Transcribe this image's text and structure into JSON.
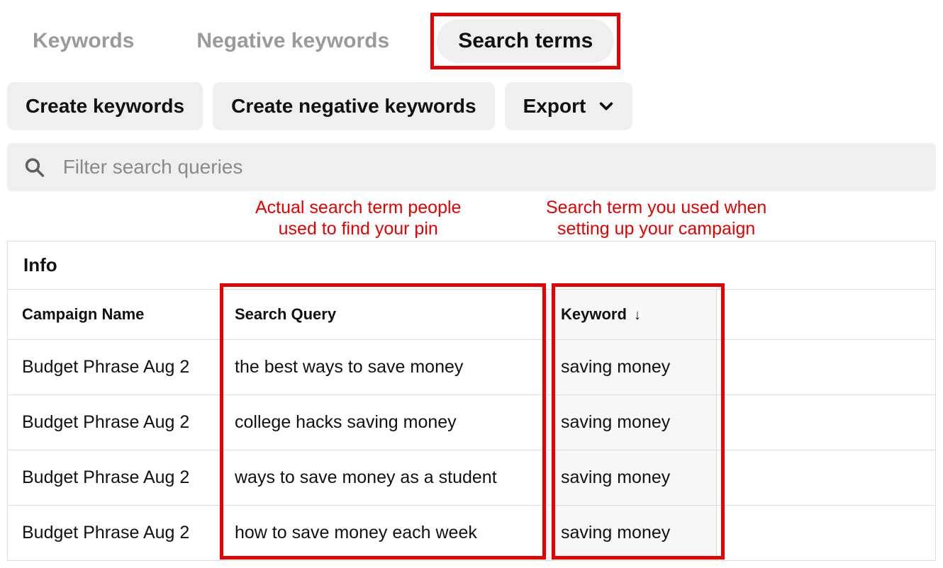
{
  "tabs": {
    "keywords": "Keywords",
    "negative": "Negative keywords",
    "search_terms": "Search terms"
  },
  "toolbar": {
    "create_keywords": "Create keywords",
    "create_negative": "Create negative keywords",
    "export": "Export"
  },
  "filter": {
    "placeholder": "Filter search queries"
  },
  "annotations": {
    "query": "Actual search term people\nused to find your pin",
    "keyword": "Search term you used when\nsetting up your campaign"
  },
  "table": {
    "info_header": "Info",
    "col_campaign": "Campaign Name",
    "col_query": "Search Query",
    "col_keyword": "Keyword",
    "rows": [
      {
        "campaign": "Budget Phrase Aug 2",
        "query": "the best ways to save money",
        "keyword": "saving money"
      },
      {
        "campaign": "Budget Phrase Aug 2",
        "query": "college hacks saving money",
        "keyword": "saving money"
      },
      {
        "campaign": "Budget Phrase Aug 2",
        "query": "ways to save money as a student",
        "keyword": "saving money"
      },
      {
        "campaign": "Budget Phrase Aug 2",
        "query": "how to save money each week",
        "keyword": "saving money"
      }
    ]
  }
}
